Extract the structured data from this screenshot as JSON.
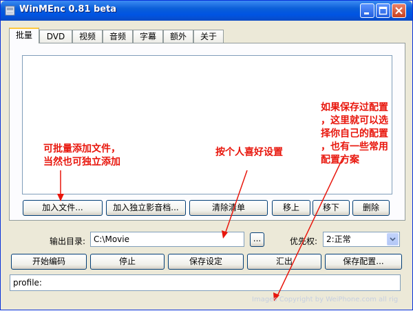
{
  "window": {
    "title": "WinMEnc 0.81 beta"
  },
  "tabs": [
    {
      "label": "批量"
    },
    {
      "label": "DVD"
    },
    {
      "label": "视频"
    },
    {
      "label": "音频"
    },
    {
      "label": "字幕"
    },
    {
      "label": "额外"
    },
    {
      "label": "关于"
    }
  ],
  "batch_buttons": {
    "add_files": "加入文件...",
    "add_separate": "加入独立影音档...",
    "clear_list": "清除清单",
    "move_up": "移上",
    "move_down": "移下",
    "delete": "删除"
  },
  "output": {
    "dir_label": "输出目录:",
    "dir_value": "C:\\Movie",
    "browse": "...",
    "priority_label": "优先权:",
    "priority_value": "2:正常"
  },
  "actions": {
    "start": "开始编码",
    "stop": "停止",
    "save_settings": "保存设定",
    "export": "汇出",
    "save_config": "保存配置..."
  },
  "profile": {
    "label": "profile:"
  },
  "annotations": {
    "batch_line1": "可批量添加文件，",
    "batch_line2": "当然也可独立添加",
    "settings": "按个人喜好设置",
    "config_line1": "如果保存过配置",
    "config_line2": "，这里就可以选",
    "config_line3": "择你自己的配置",
    "config_line4": "，也有一些常用",
    "config_line5": "配置方案"
  },
  "watermark": "Images Copyright by WeiPhone.com all rig",
  "colors": {
    "annotation": "#e8160c",
    "titlebar": "#0054e3",
    "tab_highlight": "#ffc83c",
    "window_bg": "#ece9d8"
  }
}
